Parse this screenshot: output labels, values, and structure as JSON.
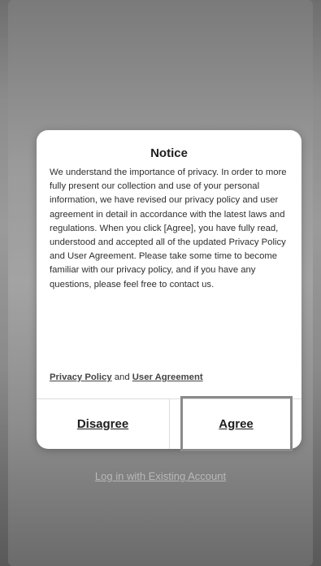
{
  "background": {
    "link_label": "Log in with Existing Account"
  },
  "dialog": {
    "title": "Notice",
    "body": "We understand the importance of privacy. In order to more fully present our collection and use of your personal information, we have revised our privacy policy and user agreement in detail in accordance with the latest laws and regulations. When you click [Agree], you have fully read, understood and accepted all of the updated Privacy Policy and User Agreement. Please take some time to become familiar with our privacy policy, and if you have any questions, please feel free to contact us.",
    "privacy_link": "Privacy Policy",
    "and_text": " and ",
    "agreement_link": "User Agreement",
    "disagree_label": "Disagree",
    "agree_label": "Agree"
  }
}
